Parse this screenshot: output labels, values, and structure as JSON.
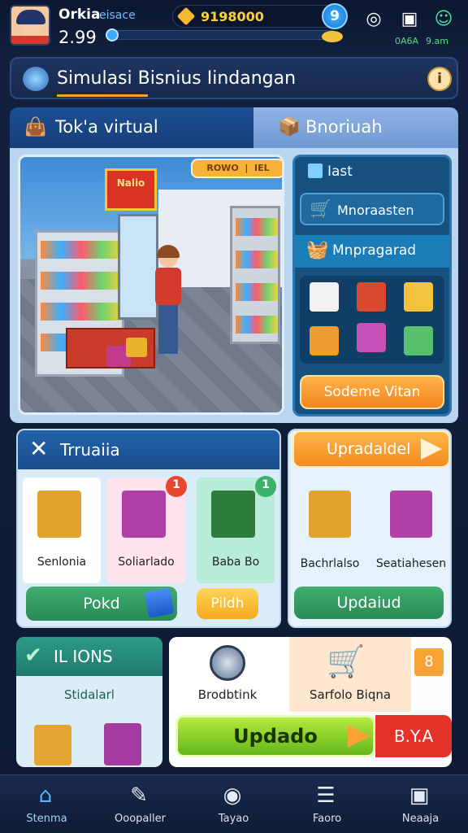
{
  "hud": {
    "player_name": "Orkia",
    "player_tag": "eisace",
    "level": "2.99",
    "cash": "9198000",
    "cash_plus": "9",
    "xp_fraction": 0.02,
    "stats_left": "0A6A",
    "stats_right": "9.am"
  },
  "title": {
    "text": "Simulasi Bisnius Iindangan"
  },
  "tabs": {
    "tab1": "Tok'a virtual",
    "tab2": "Bnoriuah"
  },
  "scene": {
    "sign": "Nalio",
    "tag_left": "ROWO",
    "tag_right": "IEL"
  },
  "side": {
    "header": "Iast",
    "row1": "Mnoraasten",
    "row2": "Mnpragarad",
    "button": "Sodeme Vitan"
  },
  "middle": {
    "header": "Trruaiia",
    "cards": [
      {
        "title": "Senlonia",
        "sub": "",
        "badge": ""
      },
      {
        "title": "Soliarlado",
        "sub": "",
        "badge": "1"
      },
      {
        "title": "Baba Bo",
        "sub": "",
        "badge": "1"
      }
    ],
    "btn_green": "Pokd",
    "btn_yellow": "Pildh"
  },
  "right": {
    "header": "Upradaldel",
    "cards": [
      {
        "title": "Bachrlalso"
      },
      {
        "title": "Seatiahesen"
      }
    ],
    "button": "Updaiud"
  },
  "bottom_left": {
    "header": "IL IONS",
    "sub": "Stidalarl"
  },
  "bottom_right": {
    "item1": "Brodbtink",
    "item2": "Sarfolo Biqna",
    "badge": "8",
    "big_button": "Updado",
    "red_label": "B.Y.A"
  },
  "nav": [
    {
      "label": "Stenma",
      "icon": "home-icon",
      "active": true
    },
    {
      "label": "Ooopaller",
      "icon": "wrench-icon",
      "active": false
    },
    {
      "label": "Tayao",
      "icon": "target-icon",
      "active": false
    },
    {
      "label": "Faoro",
      "icon": "list-icon",
      "active": false
    },
    {
      "label": "Neaaja",
      "icon": "image-icon",
      "active": false
    }
  ],
  "colors": {
    "accent_blue": "#1d4f93",
    "accent_orange": "#f28a21",
    "accent_green": "#288a55"
  }
}
